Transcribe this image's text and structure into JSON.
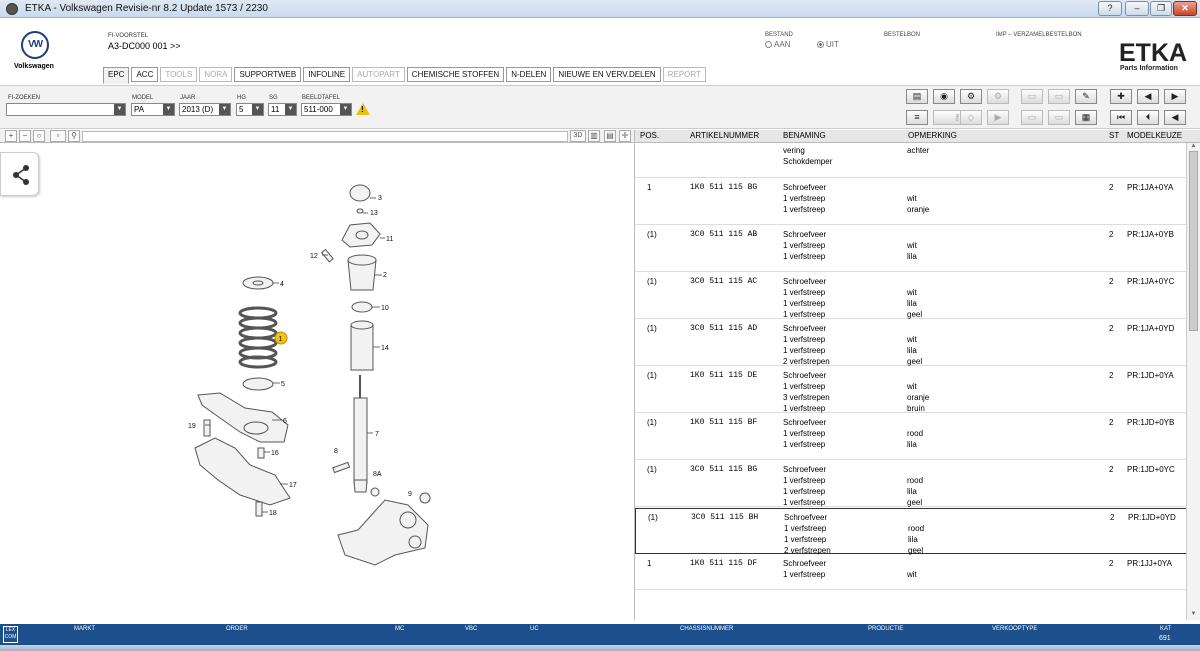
{
  "window": {
    "title": "ETKA - Volkswagen Revisie-nr 8.2 Update 1573 / 2230",
    "controls": [
      "?",
      "–",
      "❐",
      "✕"
    ]
  },
  "brand": {
    "name": "Volkswagen",
    "logo": "ETKA",
    "logo_sub": "Parts Information"
  },
  "header": {
    "fi_voorstel_label": "FI-VOORSTEL",
    "fi_voorstel_value": "A3-DC000 001 >>",
    "bestand_label": "BESTAND",
    "radio_aan": "AAN",
    "radio_uit": "UIT",
    "bestand_selected": "UIT",
    "bestelbon_label": "BESTELBON",
    "imp_label": "IMP – VERZAMELBESTELBON"
  },
  "tabs": [
    {
      "label": "EPC",
      "state": "active"
    },
    {
      "label": "ACC",
      "state": "enabled"
    },
    {
      "label": "TOOLS",
      "state": "disabled"
    },
    {
      "label": "NORA",
      "state": "disabled"
    },
    {
      "label": "SUPPORTWEB",
      "state": "enabled"
    },
    {
      "label": "INFOLINE",
      "state": "enabled"
    },
    {
      "label": "AUTOPART",
      "state": "disabled"
    },
    {
      "label": "CHEMISCHE STOFFEN",
      "state": "enabled"
    },
    {
      "label": "N-DELEN",
      "state": "enabled"
    },
    {
      "label": "NIEUWE EN VERV.DELEN",
      "state": "enabled"
    },
    {
      "label": "REPORT",
      "state": "disabled"
    }
  ],
  "filters": {
    "fi_zoeken_label": "FI-ZOEKEN",
    "fi_zoeken_value": "",
    "model_label": "MODEL",
    "model_value": "PA",
    "jaar_label": "JAAR",
    "jaar_value": "2013 (D)",
    "hg_label": "HG",
    "hg_value": "5",
    "sg_label": "SG",
    "sg_value": "11",
    "beeldtafel_label": "BEELDTAFEL",
    "beeldtafel_value": "511-000"
  },
  "toolbar_icons": {
    "row1": [
      "printer-icon",
      "search-parts-icon",
      "vehicle-icon",
      "vehicle-dim-icon",
      "notes-dim-icon",
      "car-dim-icon",
      "cart-edit-icon",
      "pin-icon",
      "prev-page-icon",
      "next-page-icon"
    ],
    "row2": [
      "list-icon",
      "key-dim-icon",
      "car2-dim-icon",
      "arrow-dim-icon",
      "copy-dim-icon",
      "doc-dim-icon",
      "cart-icon",
      "first-icon",
      "previous-icon",
      "back-icon"
    ]
  },
  "image_toolbar": {
    "label_3d": "3D"
  },
  "table": {
    "headers": {
      "pos": "POS.",
      "artikelnummer": "ARTIKELNUMMER",
      "benaming": "BENAMING",
      "opmerking": "OPMERKING",
      "st": "ST",
      "modelkeuze": "MODELKEUZE"
    },
    "group": {
      "benaming_line1": "vering",
      "benaming_line2": "Schokdemper",
      "opmerking": "achter"
    },
    "rows": [
      {
        "pos": "1",
        "part": "1K0 511 115 BG",
        "name": "Schroefveer",
        "st": "2",
        "model": "PR:1JA+0YA",
        "lines": [
          [
            "1 verfstreep",
            "wit"
          ],
          [
            "1 verfstreep",
            "oranje"
          ]
        ]
      },
      {
        "pos": "(1)",
        "part": "3C0 511 115 AB",
        "name": "Schroefveer",
        "st": "2",
        "model": "PR:1JA+0YB",
        "lines": [
          [
            "1 verfstreep",
            "wit"
          ],
          [
            "1 verfstreep",
            "lila"
          ]
        ]
      },
      {
        "pos": "(1)",
        "part": "3C0 511 115 AC",
        "name": "Schroefveer",
        "st": "2",
        "model": "PR:1JA+0YC",
        "lines": [
          [
            "1 verfstreep",
            "wit"
          ],
          [
            "1 verfstreep",
            "lila"
          ],
          [
            "1 verfstreep",
            "geel"
          ]
        ]
      },
      {
        "pos": "(1)",
        "part": "3C0 511 115 AD",
        "name": "Schroefveer",
        "st": "2",
        "model": "PR:1JA+0YD",
        "lines": [
          [
            "1 verfstreep",
            "wit"
          ],
          [
            "1 verfstreep",
            "lila"
          ],
          [
            "2 verfstrepen",
            "geel"
          ]
        ]
      },
      {
        "pos": "(1)",
        "part": "1K0 511 115 DE",
        "name": "Schroefveer",
        "st": "2",
        "model": "PR:1JD+0YA",
        "lines": [
          [
            "1 verfstreep",
            "wit"
          ],
          [
            "3 verfstrepen",
            "oranje"
          ],
          [
            "1 verfstreep",
            "bruin"
          ]
        ]
      },
      {
        "pos": "(1)",
        "part": "1K0 511 115 BF",
        "name": "Schroefveer",
        "st": "2",
        "model": "PR:1JD+0YB",
        "lines": [
          [
            "1 verfstreep",
            "rood"
          ],
          [
            "1 verfstreep",
            "lila"
          ]
        ]
      },
      {
        "pos": "(1)",
        "part": "3C0 511 115 BG",
        "name": "Schroefveer",
        "st": "2",
        "model": "PR:1JD+0YC",
        "lines": [
          [
            "1 verfstreep",
            "rood"
          ],
          [
            "1 verfstreep",
            "lila"
          ],
          [
            "1 verfstreep",
            "geel"
          ]
        ]
      },
      {
        "pos": "(1)",
        "part": "3C0 511 115 BH",
        "name": "Schroefveer",
        "st": "2",
        "model": "PR:1JD+0YD",
        "selected": true,
        "lines": [
          [
            "1 verfstreep",
            "rood"
          ],
          [
            "1 verfstreep",
            "lila"
          ],
          [
            "2 verfstrepen",
            "geel"
          ]
        ]
      },
      {
        "pos": "1",
        "part": "1K0 511 115 DF",
        "name": "Schroefveer",
        "st": "2",
        "model": "PR:1JJ+0YA",
        "lines": [
          [
            "1 verfstreep",
            "wit"
          ]
        ]
      }
    ]
  },
  "diagram": {
    "callouts": [
      "1",
      "2",
      "3",
      "4",
      "5",
      "6",
      "7",
      "8",
      "8A",
      "9",
      "10",
      "11",
      "12",
      "13",
      "14",
      "16",
      "17",
      "18",
      "19"
    ],
    "highlight_color": "#f2c21b"
  },
  "statusbar": {
    "lex_icon": "LEX COM",
    "markt_label": "MARKT",
    "order_label": "ORDER",
    "mc_label": "MC",
    "vbc_label": "VBC",
    "uc_label": "UC",
    "chassisnummer_label": "CHASSISNUMMER",
    "productie_label": "PRODUCTIE",
    "verkooptype_label": "VERKOOPTYPE",
    "kat_label": "KAT",
    "kat_value": "691"
  },
  "colors": {
    "statusbar_bg": "#1d4f8c",
    "brand_blue": "#1d3e7a",
    "warning": "#e8c30e"
  }
}
